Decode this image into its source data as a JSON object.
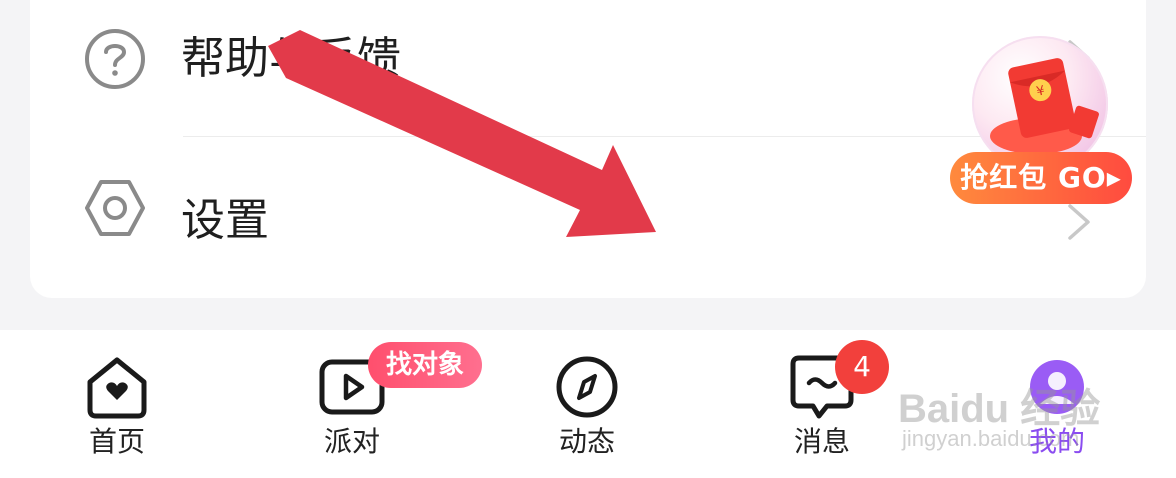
{
  "settings_list": {
    "items": [
      {
        "label": "帮助与反馈",
        "icon": "question-circle-icon"
      },
      {
        "label": "设置",
        "icon": "gear-hexagon-icon"
      }
    ]
  },
  "promo": {
    "label": "抢红包 GO▸",
    "icon": "red-envelope-icon"
  },
  "tabbar": {
    "tabs": [
      {
        "label": "首页",
        "icon": "home-heart-icon"
      },
      {
        "label": "派对",
        "icon": "play-video-icon",
        "badge": "找对象"
      },
      {
        "label": "动态",
        "icon": "compass-icon"
      },
      {
        "label": "消息",
        "icon": "chat-bubble-icon",
        "badge": "4"
      },
      {
        "label": "我的",
        "icon": "avatar-icon",
        "active": true
      }
    ]
  },
  "watermark": {
    "line1": "Baidu 经验",
    "line2": "jingyan.baidu.com"
  },
  "colors": {
    "accent": "#8a4cf0",
    "arrow": "#e23a4a",
    "badge_red": "#f2403c",
    "promo_gradient_start": "#ff8a3d",
    "promo_gradient_end": "#ff4b3f"
  }
}
